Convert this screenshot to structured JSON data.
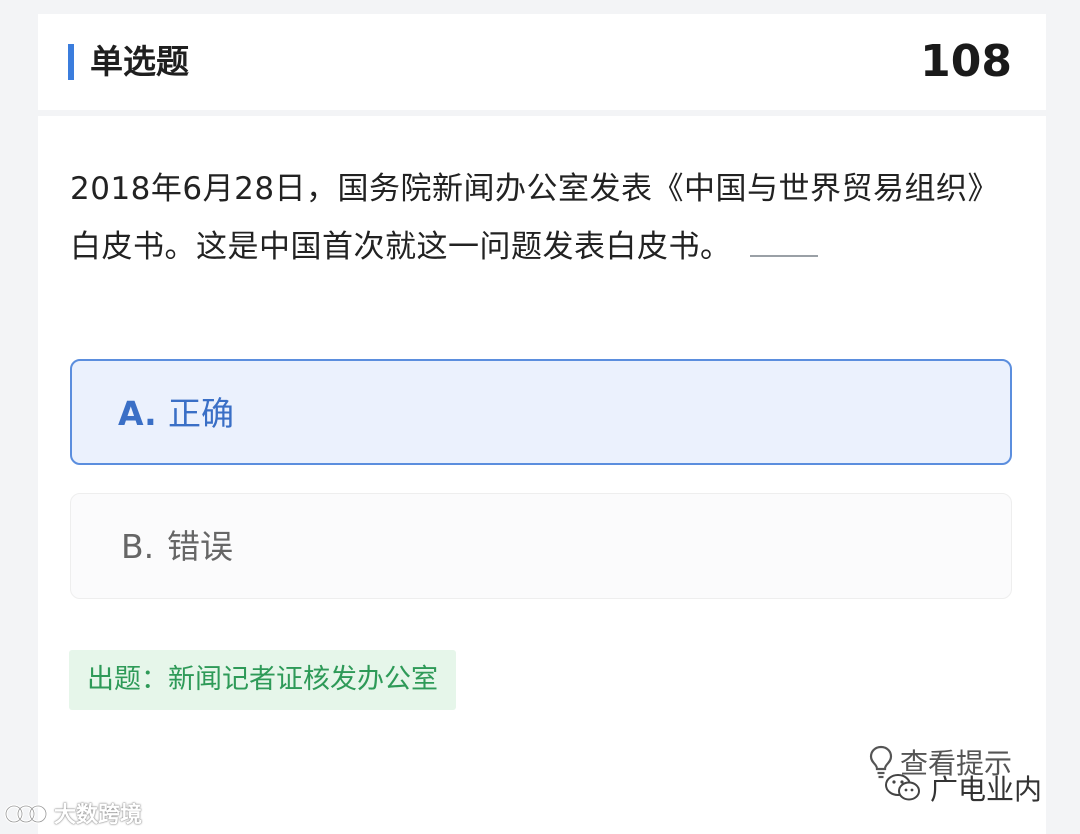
{
  "header": {
    "question_type": "单选题",
    "question_number": "108"
  },
  "question": {
    "text": "2018年6月28日，国务院新闻办公室发表《中国与世界贸易组织》白皮书。这是中国首次就这一问题发表白皮书。"
  },
  "options": [
    {
      "letter": "A.",
      "text": "正确",
      "selected": true
    },
    {
      "letter": "B.",
      "text": "错误",
      "selected": false
    }
  ],
  "source": {
    "text": "出题：新闻记者证核发办公室"
  },
  "hint": {
    "label": "查看提示",
    "icon": "lightbulb-icon"
  },
  "watermarks": {
    "left": "大数跨境",
    "right": "广电业内"
  },
  "colors": {
    "accent": "#3b7ddd",
    "selected_bg": "#ebf1fd",
    "selected_text": "#3a6fc6",
    "source_bg": "#e6f6ea",
    "source_text": "#2e9a58"
  }
}
